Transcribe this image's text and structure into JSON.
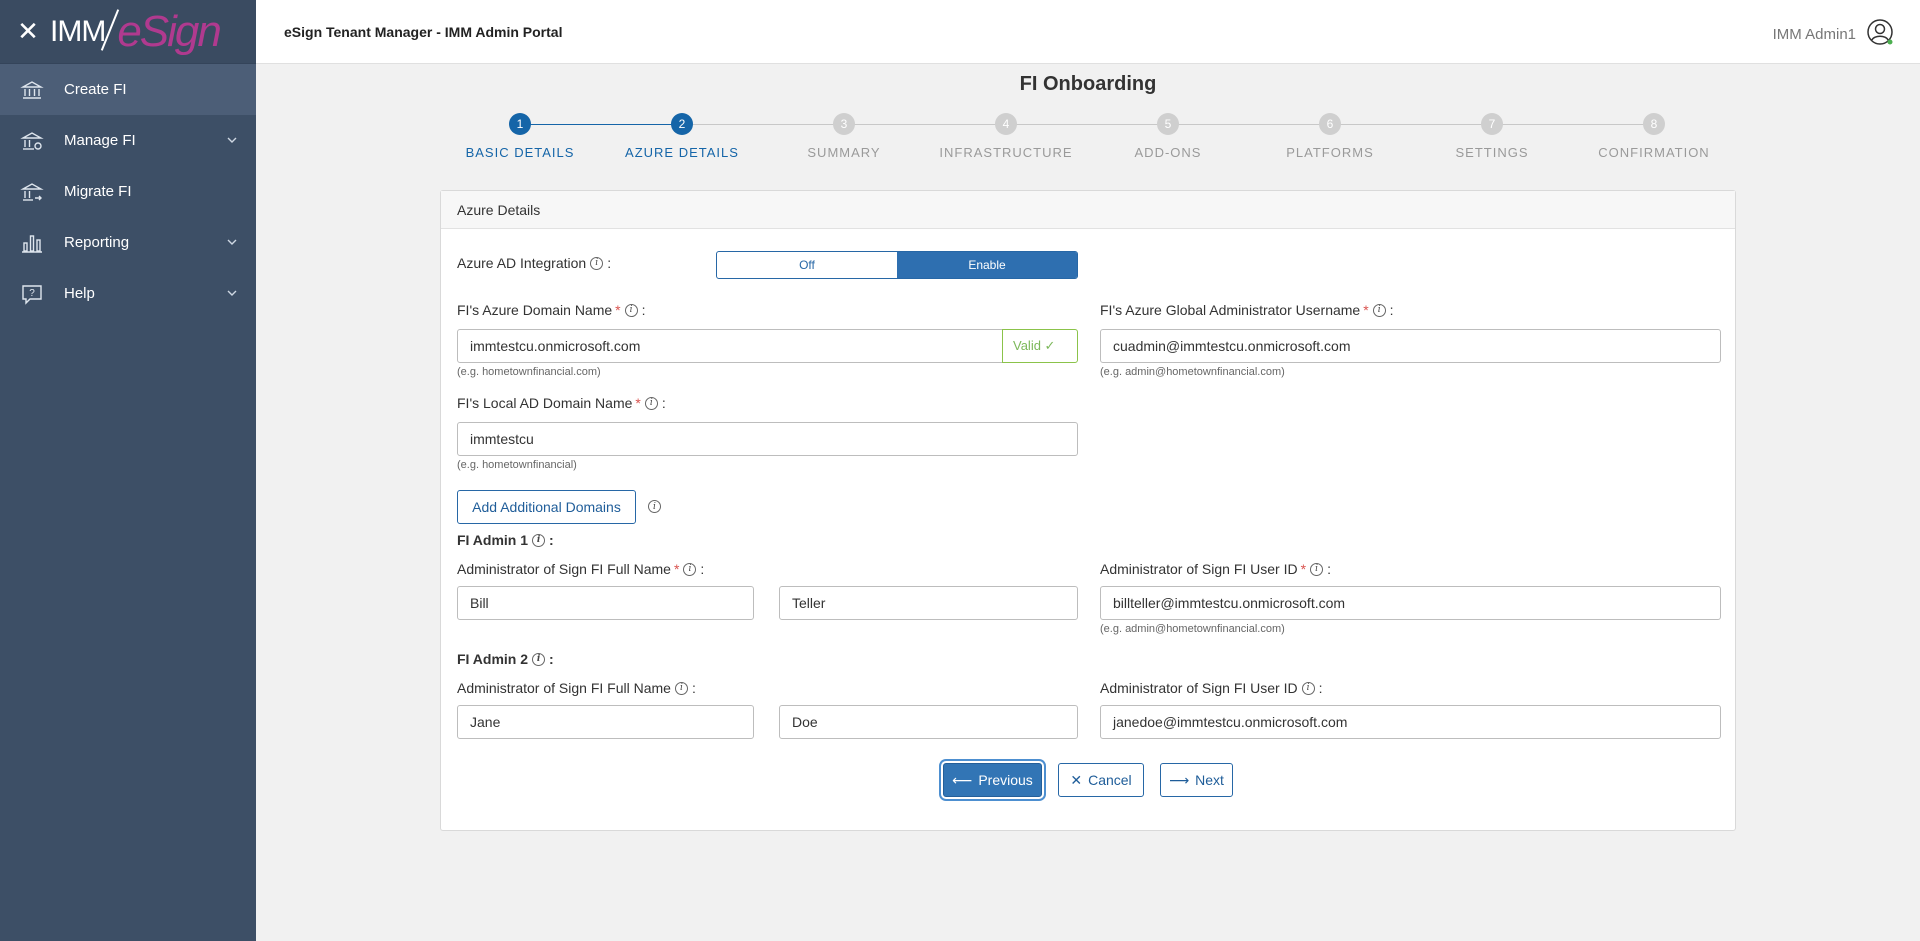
{
  "brand": {
    "imm": "IMM",
    "esign": "eSign"
  },
  "header": {
    "title": "eSign Tenant Manager - IMM Admin Portal",
    "user": "IMM Admin1"
  },
  "sidebar": {
    "items": [
      {
        "label": "Create FI",
        "icon": "bank-icon",
        "active": true
      },
      {
        "label": "Manage FI",
        "icon": "bank-gear-icon",
        "expandable": true
      },
      {
        "label": "Migrate FI",
        "icon": "bank-arrow-icon"
      },
      {
        "label": "Reporting",
        "icon": "bar-chart-icon",
        "expandable": true
      },
      {
        "label": "Help",
        "icon": "help-icon",
        "expandable": true
      }
    ]
  },
  "page": {
    "title": "FI Onboarding"
  },
  "stepper": {
    "steps": [
      {
        "num": "1",
        "label": "BASIC DETAILS",
        "state": "done"
      },
      {
        "num": "2",
        "label": "AZURE DETAILS",
        "state": "current"
      },
      {
        "num": "3",
        "label": "SUMMARY",
        "state": "pending"
      },
      {
        "num": "4",
        "label": "INFRASTRUCTURE",
        "state": "pending"
      },
      {
        "num": "5",
        "label": "ADD-ONS",
        "state": "pending"
      },
      {
        "num": "6",
        "label": "PLATFORMS",
        "state": "pending"
      },
      {
        "num": "7",
        "label": "SETTINGS",
        "state": "pending"
      },
      {
        "num": "8",
        "label": "CONFIRMATION",
        "state": "pending"
      }
    ]
  },
  "form": {
    "card_title": "Azure Details",
    "azure_ad": {
      "label": "Azure AD Integration",
      "off": "Off",
      "enable": "Enable",
      "selected": "Enable"
    },
    "azure_domain": {
      "label": "FI's Azure Domain Name",
      "value": "immtestcu.onmicrosoft.com",
      "valid": "Valid ✓",
      "hint": "(e.g. hometownfinancial.com)"
    },
    "global_admin": {
      "label": "FI's Azure Global Administrator Username",
      "value": "cuadmin@immtestcu.onmicrosoft.com",
      "hint": "(e.g. admin@hometownfinancial.com)"
    },
    "local_domain": {
      "label": "FI's Local AD Domain Name",
      "value": "immtestcu",
      "hint": "(e.g. hometownfinancial)"
    },
    "add_domains": "Add Additional Domains",
    "admin1": {
      "title": "FI Admin 1",
      "name_label": "Administrator of Sign FI Full Name",
      "first": "Bill",
      "last": "Teller",
      "id_label": "Administrator of Sign FI User ID",
      "id": "billteller@immtestcu.onmicrosoft.com",
      "hint": "(e.g. admin@hometownfinancial.com)"
    },
    "admin2": {
      "title": "FI Admin 2",
      "name_label": "Administrator of Sign FI Full Name",
      "first": "Jane",
      "last": "Doe",
      "id_label": "Administrator of Sign FI User ID",
      "id": "janedoe@immtestcu.onmicrosoft.com"
    },
    "buttons": {
      "previous": "Previous",
      "cancel": "Cancel",
      "next": "Next"
    }
  },
  "colors": {
    "sidebar": "#3d4f66",
    "accent": "#1565a8",
    "valid": "#7cb85a",
    "required": "#d9534f",
    "esign": "#b03a8f"
  }
}
